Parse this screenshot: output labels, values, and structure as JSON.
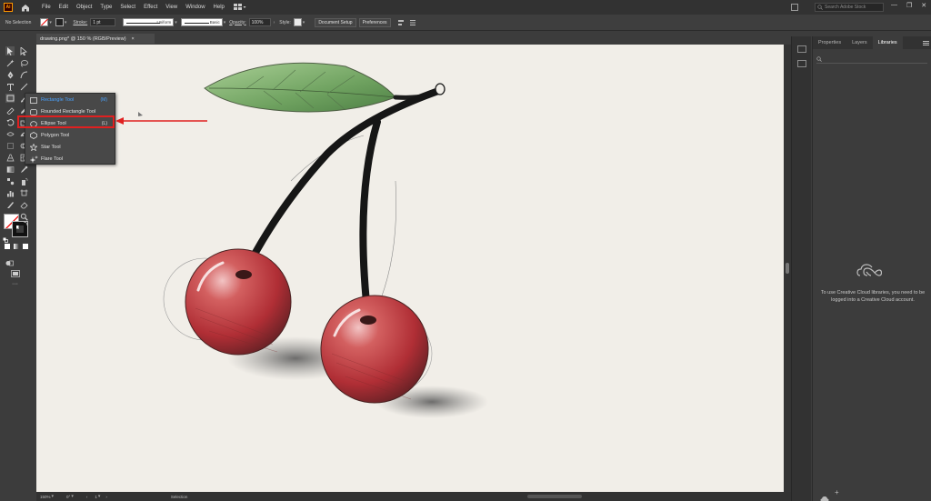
{
  "app": {
    "logo_text": "Ai"
  },
  "menubar": {
    "items": [
      "File",
      "Edit",
      "Object",
      "Type",
      "Select",
      "Effect",
      "View",
      "Window",
      "Help"
    ],
    "search_placeholder": "Search Adobe Stock",
    "window_controls": [
      "—",
      "❐",
      "✕"
    ]
  },
  "control_bar": {
    "selection_label": "No Selection",
    "stroke_label": "Stroke:",
    "stroke_weight": "1 pt",
    "profile_label": "Uniform",
    "brush_label": "Basic",
    "opacity_label": "Opacity:",
    "opacity_value": "100%",
    "style_label": "Style:",
    "document_setup": "Document Setup",
    "preferences": "Preferences"
  },
  "document": {
    "tab_title": "drawing.png* @ 150 % (RGB/Preview)",
    "close": "×"
  },
  "shape_flyout": {
    "items": [
      {
        "label": "Rectangle Tool",
        "shortcut": "(M)",
        "icon": "rectangle-icon"
      },
      {
        "label": "Rounded Rectangle Tool",
        "shortcut": "",
        "icon": "rounded-rectangle-icon"
      },
      {
        "label": "Ellipse Tool",
        "shortcut": "(L)",
        "icon": "ellipse-icon"
      },
      {
        "label": "Polygon Tool",
        "shortcut": "",
        "icon": "polygon-icon"
      },
      {
        "label": "Star Tool",
        "shortcut": "",
        "icon": "star-icon"
      },
      {
        "label": "Flare Tool",
        "shortcut": "",
        "icon": "flare-icon"
      }
    ],
    "selected_index": 0,
    "highlighted_index": 2
  },
  "right_panel": {
    "tabs": [
      "Properties",
      "Layers",
      "Libraries"
    ],
    "active_tab": "Libraries",
    "message": "To use Creative Cloud libraries, you need to be logged into a Creative Cloud account."
  },
  "statusbar": {
    "zoom": "150%",
    "rotation": "0°",
    "artboard": "1",
    "tool_name": "Selection"
  },
  "colors": {
    "highlight": "#e02020",
    "selected_text": "#4aa3ff",
    "accent": "#ff9a00"
  }
}
